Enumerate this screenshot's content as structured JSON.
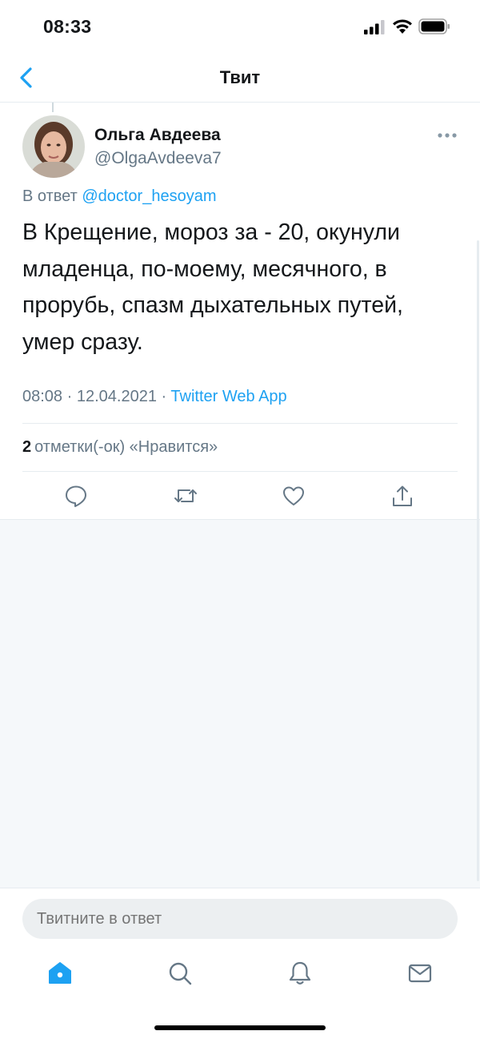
{
  "status_bar": {
    "time": "08:33"
  },
  "nav": {
    "title": "Твит",
    "back_icon": "chevron-left-icon"
  },
  "tweet": {
    "author_name": "Ольга Авдеева",
    "author_handle": "@OlgaAvdeeva7",
    "reply_prefix": "В ответ",
    "reply_mention": "@doctor_hesoyam",
    "text": "В Крещение, мороз за - 20, окунули младенца, по-моему, месячного, в прорубь, спазм дыхательных путей, умер сразу.",
    "time": "08:08",
    "date": "12.04.2021",
    "separator": "·",
    "source": "Twitter Web App",
    "likes_count": "2",
    "likes_label": "отметки(-ок) «Нравится»"
  },
  "composer": {
    "placeholder": "Твитните в ответ"
  },
  "colors": {
    "accent": "#1da1f2",
    "muted": "#657786",
    "text": "#14171a",
    "border": "#e6ecf0",
    "background_gray": "#f5f8fa"
  },
  "tabs": [
    "home-icon",
    "search-icon",
    "bell-icon",
    "mail-icon"
  ]
}
